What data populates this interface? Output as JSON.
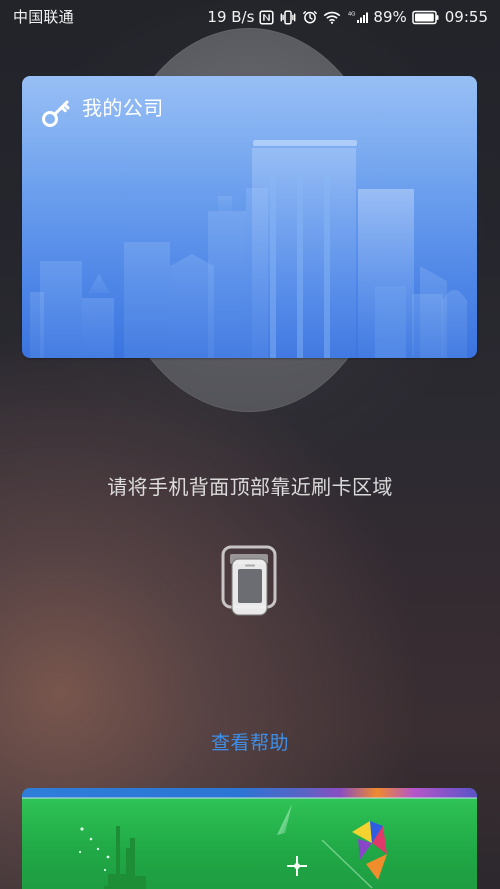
{
  "status_bar": {
    "carrier": "中国联通",
    "speed": "19 B/s",
    "network": "4G",
    "battery": "89%",
    "time": "09:55"
  },
  "access_card": {
    "title": "我的公司"
  },
  "instruction": "请将手机背面顶部靠近刷卡区域",
  "help": {
    "label": "查看帮助"
  },
  "colors": {
    "accent_blue": "#3f8fe8",
    "card_blue_top": "#8cb8f4",
    "card_blue_bottom": "#3b74df",
    "bottom_card_green": "#29b84f"
  },
  "icons": {
    "key": "key-icon",
    "phone": "phone-icon",
    "nfc": "nfc-icon",
    "vibrate": "vibrate-icon",
    "alarm": "alarm-icon",
    "wifi": "wifi-icon",
    "signal": "signal-icon",
    "battery": "battery-icon"
  }
}
